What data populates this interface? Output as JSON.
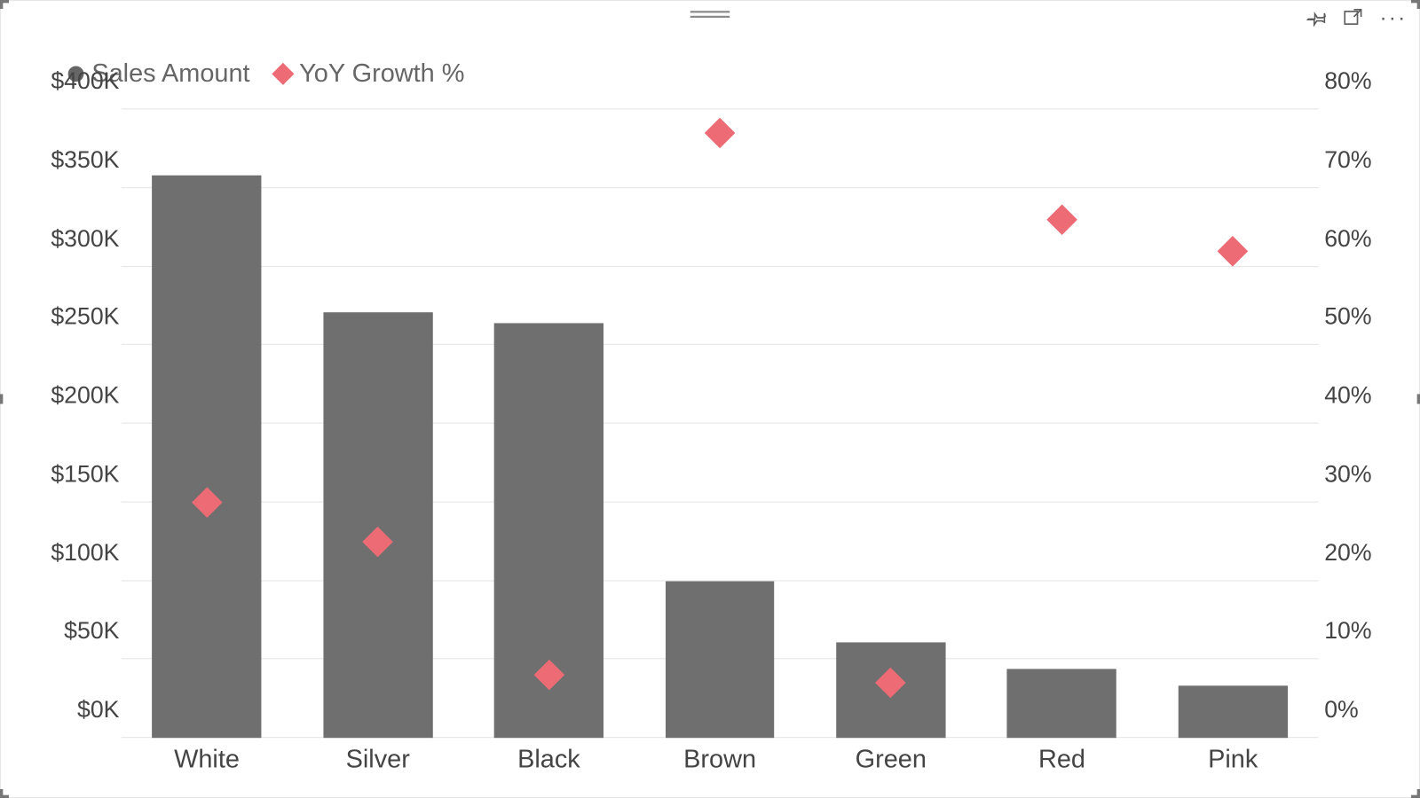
{
  "legend": {
    "bar_label": "Sales Amount",
    "marker_label": "YoY Growth %"
  },
  "colors": {
    "bar": "#6f6f6f",
    "marker": "#ec6b74",
    "grid": "#e6e6e6"
  },
  "chart_data": {
    "type": "bar",
    "categories": [
      "White",
      "Silver",
      "Black",
      "Brown",
      "Green",
      "Red",
      "Pink"
    ],
    "series": [
      {
        "name": "Sales Amount",
        "kind": "bar",
        "axis": "left",
        "values": [
          358000,
          271000,
          264000,
          100000,
          61000,
          44000,
          33000
        ]
      },
      {
        "name": "YoY Growth %",
        "kind": "marker",
        "axis": "right",
        "values": [
          30,
          25,
          8,
          77,
          7,
          66,
          62
        ]
      }
    ],
    "y_left": {
      "min": 0,
      "max": 400000,
      "ticks": [
        0,
        50000,
        100000,
        150000,
        200000,
        250000,
        300000,
        350000,
        400000
      ],
      "tick_labels": [
        "$0K",
        "$50K",
        "$100K",
        "$150K",
        "$200K",
        "$250K",
        "$300K",
        "$350K",
        "$400K"
      ]
    },
    "y_right": {
      "min": 0,
      "max": 80,
      "ticks": [
        0,
        10,
        20,
        30,
        40,
        50,
        60,
        70,
        80
      ],
      "tick_labels": [
        "0%",
        "10%",
        "20%",
        "30%",
        "40%",
        "50%",
        "60%",
        "70%",
        "80%"
      ]
    }
  }
}
